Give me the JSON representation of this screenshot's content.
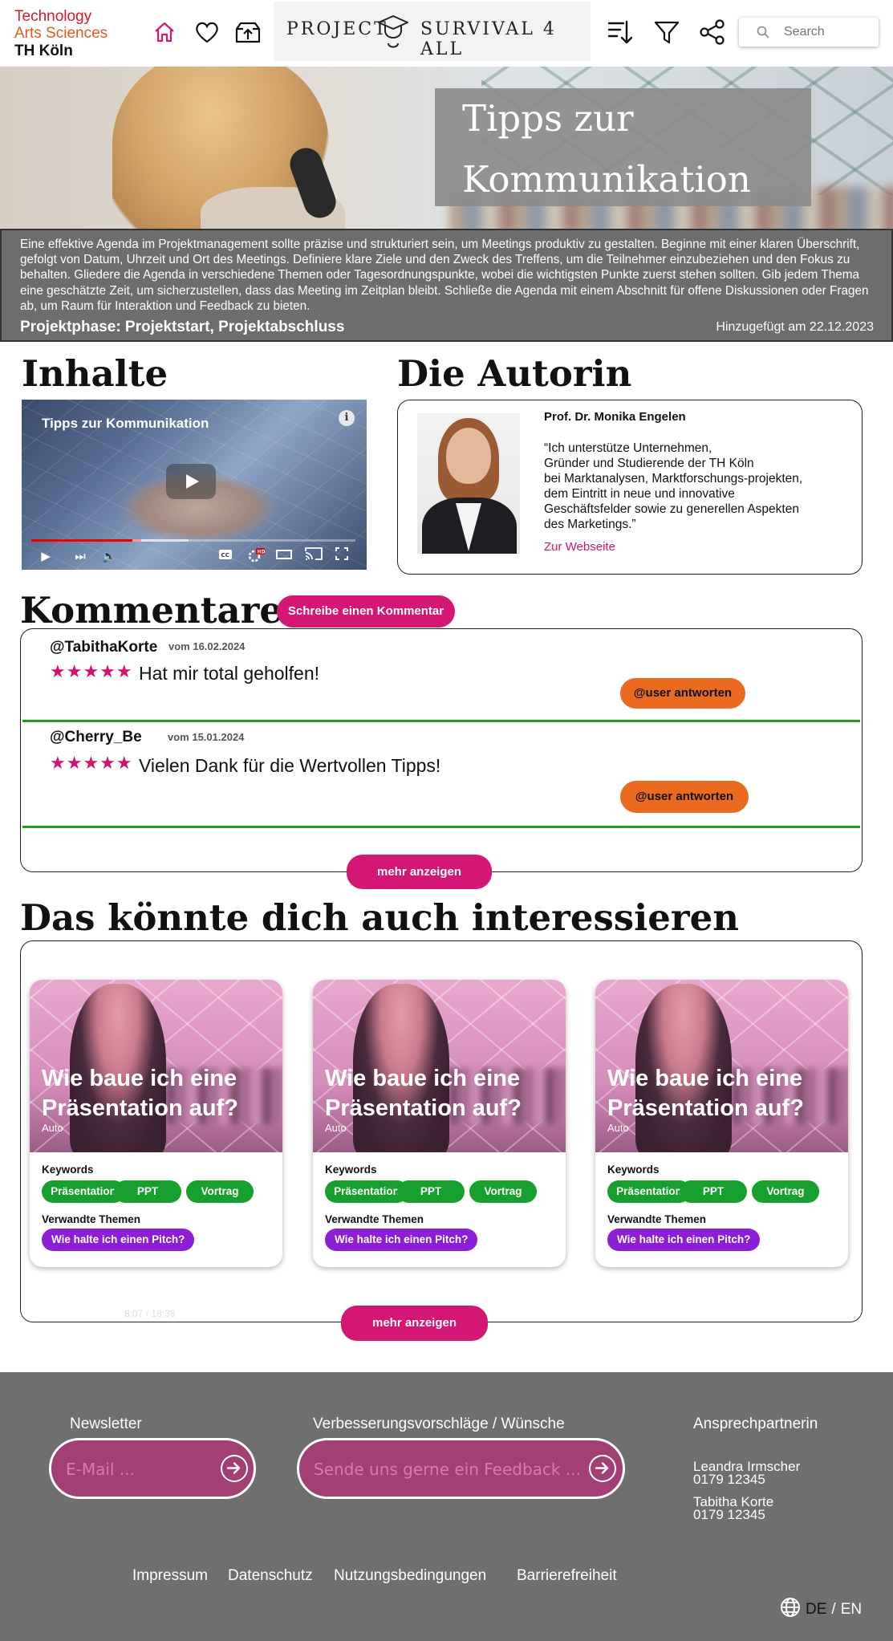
{
  "header": {
    "logo": {
      "line1": "Technology",
      "line2": "Arts Sciences",
      "line3": "TH Köln",
      "color1": "#d01a2e",
      "color2": "#e05a1a"
    },
    "icons": [
      "home-icon",
      "heart-icon",
      "upload-icon",
      "graduation-cap-icon",
      "sort-icon",
      "filter-icon",
      "share-icon",
      "search-icon"
    ],
    "project_word1": "PROJECT",
    "project_word2": "SURVIVAL 4 ALL",
    "search": {
      "placeholder": "Search"
    }
  },
  "hero": {
    "title_line1": "Tipps zur",
    "title_line2": "Kommunikation",
    "description": "Eine effektive Agenda im Projektmanagement sollte präzise und strukturiert sein, um Meetings produktiv zu gestalten. Beginne mit einer klaren Überschrift, gefolgt von Datum, Uhrzeit und Ort des Meetings. Definiere klare Ziele und den Zweck des Treffens, um die Teilnehmer einzubeziehen und den Fokus zu behalten. Gliedere die Agenda in verschiedene Themen oder Tagesordnungspunkte, wobei die wichtigsten Punkte zuerst stehen sollten. Gib jedem Thema eine geschätzte Zeit, um sicherzustellen, dass das Meeting im Zeitplan bleibt. Schließe die Agenda mit einem Abschnitt für offene Diskussionen oder Fragen ab, um Raum für Interaktion und Feedback zu bieten.",
    "phase": "Projektphase: Projektstart, Projektabschluss",
    "added": "Hinzugefügt am 22.12.2023"
  },
  "content": {
    "heading": "Inhalte",
    "video": {
      "title": "Tipps zur Kommunikation",
      "info": "i",
      "progress": 0.34,
      "hd_badge": "HD"
    }
  },
  "author": {
    "heading": "Die Autorin",
    "name": "Prof. Dr. Monika Engelen",
    "quote": "“Ich unterstütze Unternehmen,\nGründer und Studierende der TH Köln\nbei Marktanalysen, Marktforschungs-projekten,\ndem Eintritt in neue und innovative\nGeschäftsfelder sowie zu generellen Aspekten\ndes Marketings.”",
    "link": "Zur Webseite"
  },
  "comments": {
    "heading": "Kommentare",
    "write_button": "Schreibe einen Kommentar",
    "items": [
      {
        "user": "@TabithaKorte",
        "date": "vom 16.02.2024",
        "stars": "★★★★★",
        "rating": 5,
        "text": "Hat mir total geholfen!",
        "reply": "@user antworten"
      },
      {
        "user": "@Cherry_Be",
        "date": "vom 15.01.2024",
        "stars": "★★★★★",
        "rating": 5,
        "text": "Vielen Dank für die Wertvollen Tipps!",
        "reply": "@user antworten"
      }
    ],
    "more": "mehr anzeigen"
  },
  "related": {
    "heading": "Das könnte dich auch interessieren",
    "cards": [
      {
        "title": "Wie baue ich eine Präsentation auf?",
        "author": "Auto",
        "keywords_label": "Keywords",
        "keywords": [
          "Präsentation",
          "PPT",
          "Vortrag"
        ],
        "topics_label": "Verwandte Themen",
        "topic": "Wie halte ich einen Pitch?"
      },
      {
        "title": "Wie baue ich eine Präsentation auf?",
        "author": "Auto",
        "keywords_label": "Keywords",
        "keywords": [
          "Präsentation",
          "PPT",
          "Vortrag"
        ],
        "topics_label": "Verwandte Themen",
        "topic": "Wie halte ich einen Pitch?"
      },
      {
        "title": "Wie baue ich eine Präsentation auf?",
        "author": "Auto",
        "keywords_label": "Keywords",
        "keywords": [
          "Präsentation",
          "PPT",
          "Vortrag"
        ],
        "topics_label": "Verwandte Themen",
        "topic": "Wie halte ich einen Pitch?"
      }
    ],
    "ghost_time": "8:07 / 18:38",
    "more": "mehr anzeigen"
  },
  "footer": {
    "newsletter_label": "Newsletter",
    "newsletter_placeholder": "E-Mail ...",
    "feedback_label": "Verbesserungsvorschläge / Wünsche",
    "feedback_placeholder": "Sende uns gerne ein Feedback ...",
    "contact_label": "Ansprechpartnerin",
    "contacts": [
      {
        "name": "Leandra Irmscher",
        "phone": "0179 12345"
      },
      {
        "name": "Tabitha Korte",
        "phone": "0179 12345"
      }
    ],
    "links": [
      "Impressum",
      "Datenschutz",
      "Nutzungsbedingungen",
      "Barrierefreiheit"
    ],
    "lang_de": "DE",
    "lang_sep": "/",
    "lang_en": "EN"
  },
  "colors": {
    "accent_pink": "#d41675",
    "orange": "#ea6a20",
    "green": "#17a02d",
    "purple": "#8c1fd6",
    "footer_bg": "#6f6f6f"
  }
}
